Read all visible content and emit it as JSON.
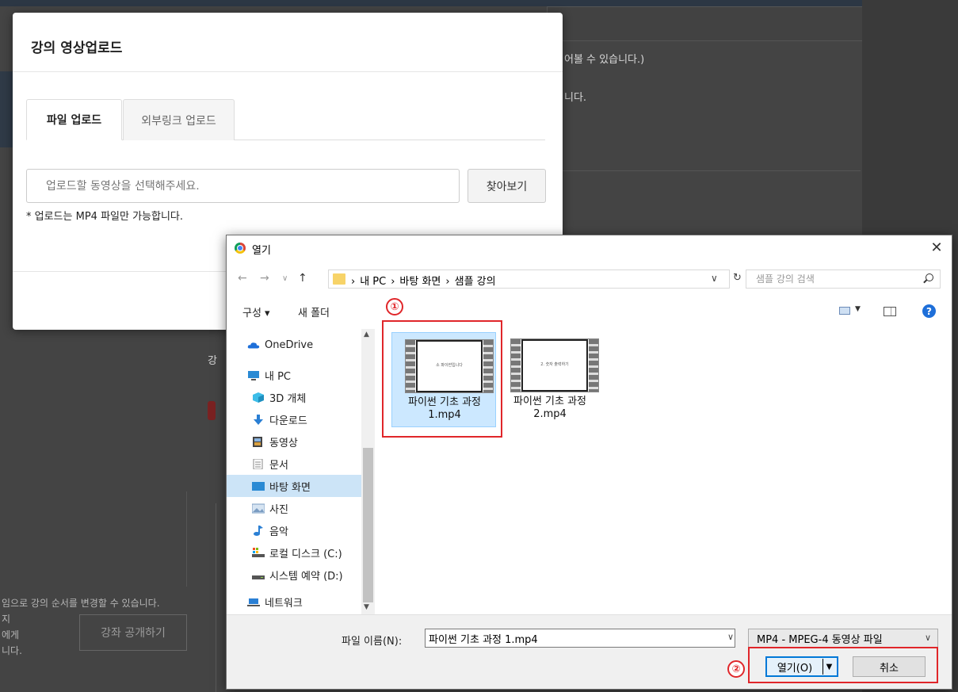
{
  "background": {
    "text_top": "어볼 수 있습니다.)",
    "text_second": "니다.",
    "text_side": "강",
    "left_lines": [
      "임으로 강의 순서를 변경할 수 있습니다.",
      "지",
      "에게",
      "니다."
    ],
    "publish_button": "강좌 공개하기"
  },
  "modal": {
    "title": "강의 영상업로드",
    "tabs": [
      {
        "label": "파일 업로드",
        "active": true
      },
      {
        "label": "외부링크 업로드",
        "active": false
      }
    ],
    "file_placeholder": "업로드할 동영상을 선택해주세요.",
    "browse_label": "찾아보기",
    "note": "* 업로드는 MP4 파일만 가능합니다."
  },
  "dialog": {
    "title": "열기",
    "close": "✕",
    "breadcrumb": [
      "내 PC",
      "바탕 화면",
      "샘플 강의"
    ],
    "search_placeholder": "샘플 강의 검색",
    "toolbar": {
      "organize": "구성 ▾",
      "new_folder": "새 폴더"
    },
    "nav_items": [
      {
        "label": "OneDrive",
        "icon": "onedrive-icon",
        "color": "#1e6fd9"
      },
      {
        "label": "내 PC",
        "icon": "pc-icon",
        "color": "#2a8ad4"
      },
      {
        "label": "3D 개체",
        "icon": "3d-objects-icon",
        "color": "#3dbde8"
      },
      {
        "label": "다운로드",
        "icon": "download-icon",
        "color": "#2a7fd4"
      },
      {
        "label": "동영상",
        "icon": "video-icon",
        "color": "#444444"
      },
      {
        "label": "문서",
        "icon": "document-icon",
        "color": "#8a8a8a"
      },
      {
        "label": "바탕 화면",
        "icon": "desktop-icon",
        "color": "#2a8ad4"
      },
      {
        "label": "사진",
        "icon": "pictures-icon",
        "color": "#7a9cc2"
      },
      {
        "label": "음악",
        "icon": "music-icon",
        "color": "#2a7fd4"
      },
      {
        "label": "로컬 디스크 (C:)",
        "icon": "local-disk-icon",
        "color": "#555555"
      },
      {
        "label": "시스템 예약 (D:)",
        "icon": "drive-icon",
        "color": "#555555"
      },
      {
        "label": "네트워크",
        "icon": "network-icon",
        "color": "#2a7fd4"
      }
    ],
    "files": [
      {
        "line1": "파이썬 기초 과정",
        "line2": "1.mp4",
        "thumb_text": "소 파이썬입니다",
        "selected": true
      },
      {
        "line1": "파이썬 기초 과정",
        "line2": "2.mp4",
        "thumb_text": "2. 숫자 출력하기",
        "selected": false
      }
    ],
    "filename_label": "파일 이름(N):",
    "filename_value": "파이썬 기초 과정 1.mp4",
    "filetype": "MP4 - MPEG-4 동영상 파일",
    "open_label": "열기(O)",
    "cancel_label": "취소"
  },
  "annotations": {
    "step1": "①",
    "step2": "②",
    "color": "#e0262a"
  }
}
